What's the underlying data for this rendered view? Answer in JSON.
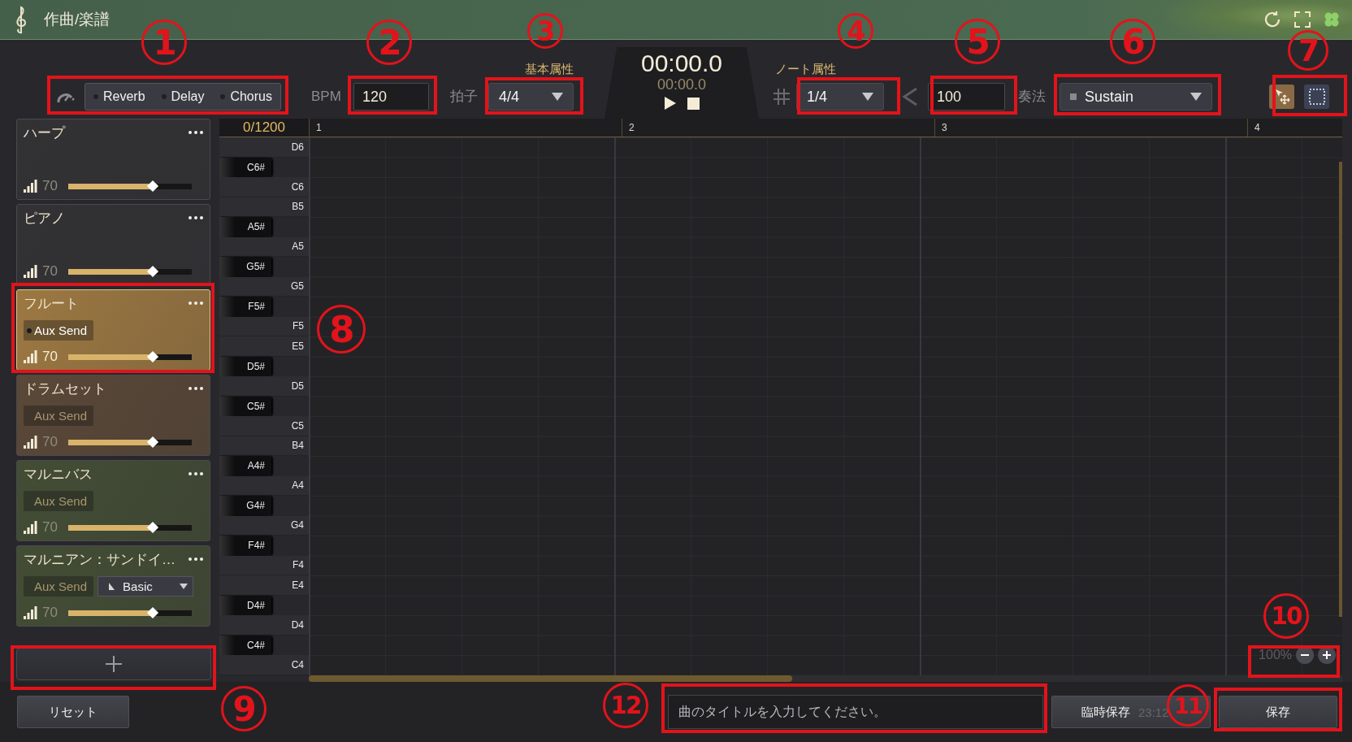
{
  "app": {
    "title": "作曲/楽譜"
  },
  "effects": [
    {
      "label": "Reverb",
      "on": false
    },
    {
      "label": "Delay",
      "on": false
    },
    {
      "label": "Chorus",
      "on": false
    }
  ],
  "bpm": {
    "label": "BPM",
    "value": "120"
  },
  "basic_attributes": {
    "label": "基本属性",
    "time_signature": {
      "label": "拍子",
      "value": "4/4"
    }
  },
  "timer": {
    "elapsed": "00:00.0",
    "total": "00:00.0"
  },
  "note_attributes": {
    "label": "ノート属性",
    "length": "1/4",
    "velocity": "100",
    "articulation": {
      "label": "奏法",
      "value": "Sustain"
    }
  },
  "tools": [
    {
      "kind": "select-move",
      "selected": true
    },
    {
      "kind": "marquee",
      "selected": false
    }
  ],
  "tracks": [
    {
      "name": "ハープ",
      "selected": false,
      "color": "#323235",
      "volume": "70",
      "level": 0.7
    },
    {
      "name": "ピアノ",
      "selected": false,
      "color": "#323235",
      "volume": "70",
      "level": 0.7
    },
    {
      "name": "フルート",
      "selected": true,
      "color": "#9c7842",
      "aux_send": {
        "label": "Aux Send",
        "on": true
      },
      "volume": "70",
      "level": 0.7
    },
    {
      "name": "ドラムセット",
      "selected": false,
      "color": "#5a4838",
      "aux_send": {
        "label": "Aux Send",
        "on": false
      },
      "volume": "70",
      "level": 0.7
    },
    {
      "name": "マルニバス",
      "selected": false,
      "color": "#434d35",
      "aux_send": {
        "label": "Aux Send",
        "on": false
      },
      "volume": "70",
      "level": 0.7
    },
    {
      "name": "マルニアン：サンドイ…",
      "selected": false,
      "color": "#434d35",
      "aux_send": {
        "label": "Aux Send",
        "on": false
      },
      "preset": "Basic",
      "volume": "70",
      "level": 0.7
    }
  ],
  "note_counter": "0/1200",
  "measures": [
    "1",
    "2",
    "3",
    "4"
  ],
  "keys": [
    {
      "label": "D6",
      "kind": "white"
    },
    {
      "label": "C6#",
      "kind": "black"
    },
    {
      "label": "C6",
      "kind": "white"
    },
    {
      "label": "B5",
      "kind": "white"
    },
    {
      "label": "A5#",
      "kind": "black"
    },
    {
      "label": "A5",
      "kind": "white"
    },
    {
      "label": "G5#",
      "kind": "black"
    },
    {
      "label": "G5",
      "kind": "white"
    },
    {
      "label": "F5#",
      "kind": "black"
    },
    {
      "label": "F5",
      "kind": "white"
    },
    {
      "label": "E5",
      "kind": "white"
    },
    {
      "label": "D5#",
      "kind": "black"
    },
    {
      "label": "D5",
      "kind": "white"
    },
    {
      "label": "C5#",
      "kind": "black"
    },
    {
      "label": "C5",
      "kind": "white"
    },
    {
      "label": "B4",
      "kind": "white"
    },
    {
      "label": "A4#",
      "kind": "black"
    },
    {
      "label": "A4",
      "kind": "white"
    },
    {
      "label": "G4#",
      "kind": "black"
    },
    {
      "label": "G4",
      "kind": "white"
    },
    {
      "label": "F4#",
      "kind": "black"
    },
    {
      "label": "F4",
      "kind": "white"
    },
    {
      "label": "E4",
      "kind": "white"
    },
    {
      "label": "D4#",
      "kind": "black"
    },
    {
      "label": "D4",
      "kind": "white"
    },
    {
      "label": "C4#",
      "kind": "black"
    },
    {
      "label": "C4",
      "kind": "white"
    }
  ],
  "zoom": {
    "value": "100%"
  },
  "footer": {
    "reset": "リセット",
    "title_placeholder": "曲のタイトルを入力してください。",
    "temp_save": "臨時保存",
    "temp_save_time": "23:12",
    "save": "保存"
  },
  "annotations": [
    {
      "number": "1"
    },
    {
      "number": "2"
    },
    {
      "number": "3"
    },
    {
      "number": "4"
    },
    {
      "number": "5"
    },
    {
      "number": "6"
    },
    {
      "number": "7"
    },
    {
      "number": "8"
    },
    {
      "number": "9"
    },
    {
      "number": "10"
    },
    {
      "number": "12"
    },
    {
      "number": "11"
    }
  ]
}
